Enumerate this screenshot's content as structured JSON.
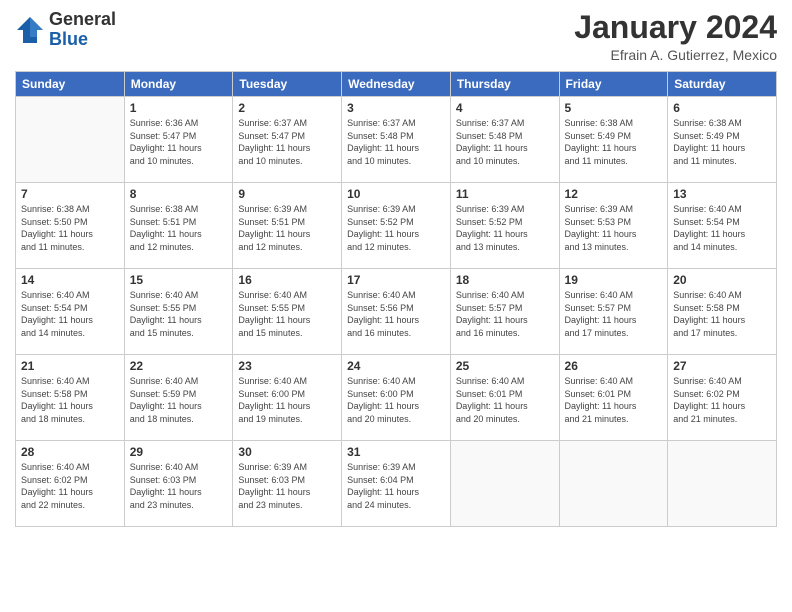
{
  "logo": {
    "general": "General",
    "blue": "Blue"
  },
  "title": "January 2024",
  "subtitle": "Efrain A. Gutierrez, Mexico",
  "days_header": [
    "Sunday",
    "Monday",
    "Tuesday",
    "Wednesday",
    "Thursday",
    "Friday",
    "Saturday"
  ],
  "weeks": [
    [
      {
        "day": "",
        "info": ""
      },
      {
        "day": "1",
        "info": "Sunrise: 6:36 AM\nSunset: 5:47 PM\nDaylight: 11 hours\nand 10 minutes."
      },
      {
        "day": "2",
        "info": "Sunrise: 6:37 AM\nSunset: 5:47 PM\nDaylight: 11 hours\nand 10 minutes."
      },
      {
        "day": "3",
        "info": "Sunrise: 6:37 AM\nSunset: 5:48 PM\nDaylight: 11 hours\nand 10 minutes."
      },
      {
        "day": "4",
        "info": "Sunrise: 6:37 AM\nSunset: 5:48 PM\nDaylight: 11 hours\nand 10 minutes."
      },
      {
        "day": "5",
        "info": "Sunrise: 6:38 AM\nSunset: 5:49 PM\nDaylight: 11 hours\nand 11 minutes."
      },
      {
        "day": "6",
        "info": "Sunrise: 6:38 AM\nSunset: 5:49 PM\nDaylight: 11 hours\nand 11 minutes."
      }
    ],
    [
      {
        "day": "7",
        "info": "Sunrise: 6:38 AM\nSunset: 5:50 PM\nDaylight: 11 hours\nand 11 minutes."
      },
      {
        "day": "8",
        "info": "Sunrise: 6:38 AM\nSunset: 5:51 PM\nDaylight: 11 hours\nand 12 minutes."
      },
      {
        "day": "9",
        "info": "Sunrise: 6:39 AM\nSunset: 5:51 PM\nDaylight: 11 hours\nand 12 minutes."
      },
      {
        "day": "10",
        "info": "Sunrise: 6:39 AM\nSunset: 5:52 PM\nDaylight: 11 hours\nand 12 minutes."
      },
      {
        "day": "11",
        "info": "Sunrise: 6:39 AM\nSunset: 5:52 PM\nDaylight: 11 hours\nand 13 minutes."
      },
      {
        "day": "12",
        "info": "Sunrise: 6:39 AM\nSunset: 5:53 PM\nDaylight: 11 hours\nand 13 minutes."
      },
      {
        "day": "13",
        "info": "Sunrise: 6:40 AM\nSunset: 5:54 PM\nDaylight: 11 hours\nand 14 minutes."
      }
    ],
    [
      {
        "day": "14",
        "info": "Sunrise: 6:40 AM\nSunset: 5:54 PM\nDaylight: 11 hours\nand 14 minutes."
      },
      {
        "day": "15",
        "info": "Sunrise: 6:40 AM\nSunset: 5:55 PM\nDaylight: 11 hours\nand 15 minutes."
      },
      {
        "day": "16",
        "info": "Sunrise: 6:40 AM\nSunset: 5:55 PM\nDaylight: 11 hours\nand 15 minutes."
      },
      {
        "day": "17",
        "info": "Sunrise: 6:40 AM\nSunset: 5:56 PM\nDaylight: 11 hours\nand 16 minutes."
      },
      {
        "day": "18",
        "info": "Sunrise: 6:40 AM\nSunset: 5:57 PM\nDaylight: 11 hours\nand 16 minutes."
      },
      {
        "day": "19",
        "info": "Sunrise: 6:40 AM\nSunset: 5:57 PM\nDaylight: 11 hours\nand 17 minutes."
      },
      {
        "day": "20",
        "info": "Sunrise: 6:40 AM\nSunset: 5:58 PM\nDaylight: 11 hours\nand 17 minutes."
      }
    ],
    [
      {
        "day": "21",
        "info": "Sunrise: 6:40 AM\nSunset: 5:58 PM\nDaylight: 11 hours\nand 18 minutes."
      },
      {
        "day": "22",
        "info": "Sunrise: 6:40 AM\nSunset: 5:59 PM\nDaylight: 11 hours\nand 18 minutes."
      },
      {
        "day": "23",
        "info": "Sunrise: 6:40 AM\nSunset: 6:00 PM\nDaylight: 11 hours\nand 19 minutes."
      },
      {
        "day": "24",
        "info": "Sunrise: 6:40 AM\nSunset: 6:00 PM\nDaylight: 11 hours\nand 20 minutes."
      },
      {
        "day": "25",
        "info": "Sunrise: 6:40 AM\nSunset: 6:01 PM\nDaylight: 11 hours\nand 20 minutes."
      },
      {
        "day": "26",
        "info": "Sunrise: 6:40 AM\nSunset: 6:01 PM\nDaylight: 11 hours\nand 21 minutes."
      },
      {
        "day": "27",
        "info": "Sunrise: 6:40 AM\nSunset: 6:02 PM\nDaylight: 11 hours\nand 21 minutes."
      }
    ],
    [
      {
        "day": "28",
        "info": "Sunrise: 6:40 AM\nSunset: 6:02 PM\nDaylight: 11 hours\nand 22 minutes."
      },
      {
        "day": "29",
        "info": "Sunrise: 6:40 AM\nSunset: 6:03 PM\nDaylight: 11 hours\nand 23 minutes."
      },
      {
        "day": "30",
        "info": "Sunrise: 6:39 AM\nSunset: 6:03 PM\nDaylight: 11 hours\nand 23 minutes."
      },
      {
        "day": "31",
        "info": "Sunrise: 6:39 AM\nSunset: 6:04 PM\nDaylight: 11 hours\nand 24 minutes."
      },
      {
        "day": "",
        "info": ""
      },
      {
        "day": "",
        "info": ""
      },
      {
        "day": "",
        "info": ""
      }
    ]
  ]
}
